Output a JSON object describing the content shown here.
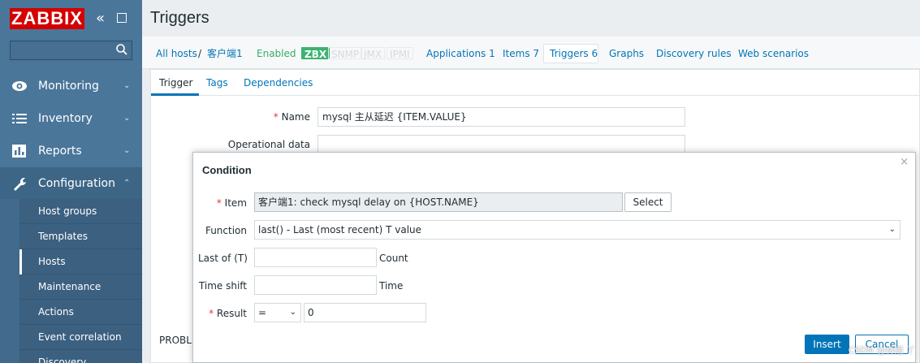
{
  "sidebar": {
    "logo": "ZABBIX",
    "search": {
      "placeholder": "",
      "value": ""
    },
    "menu": [
      {
        "label": "Monitoring",
        "icon": "eye-icon"
      },
      {
        "label": "Inventory",
        "icon": "list-icon"
      },
      {
        "label": "Reports",
        "icon": "bar-chart-icon"
      },
      {
        "label": "Configuration",
        "icon": "wrench-icon"
      }
    ],
    "submenu": [
      "Host groups",
      "Templates",
      "Hosts",
      "Maintenance",
      "Actions",
      "Event correlation",
      "Discovery"
    ],
    "active_submenu": "Hosts"
  },
  "page": {
    "title": "Triggers"
  },
  "host_nav": {
    "all_hosts": "All hosts",
    "separator": "/",
    "host": "客户端1",
    "status": "Enabled",
    "availability": [
      "ZBX",
      "SNMP",
      "JMX",
      "IPMI"
    ],
    "links": [
      "Applications 1",
      "Items 7",
      "Triggers 6",
      "Graphs",
      "Discovery rules",
      "Web scenarios"
    ]
  },
  "form": {
    "tabs": [
      "Trigger",
      "Tags",
      "Dependencies"
    ],
    "name_label": "Name",
    "name_value": "mysql 主从延迟 {ITEM.VALUE}",
    "opdata_label": "Operational data",
    "opdata_value": "",
    "problem_label": "PROBL"
  },
  "dialog": {
    "title": "Condition",
    "close": "×",
    "item_label": "Item",
    "item_value": "客户端1: check mysql delay on {HOST.NAME}",
    "select_button": "Select",
    "function_label": "Function",
    "function_value": "last() - Last (most recent) T value",
    "last_of_label": "Last of (T)",
    "last_of_value": "",
    "count_label": "Count",
    "time_shift_label": "Time shift",
    "time_shift_value": "",
    "time_label": "Time",
    "result_label": "Result",
    "result_operator": "=",
    "result_value": "0",
    "insert_button": "Insert",
    "cancel_button": "Cancel"
  },
  "watermark": "CSDN @林雨 丫",
  "colors": {
    "brand": "#d40000",
    "sidebar": "#4a769a",
    "link": "#0275b8",
    "enabled": "#34af67",
    "required": "#e33734"
  }
}
